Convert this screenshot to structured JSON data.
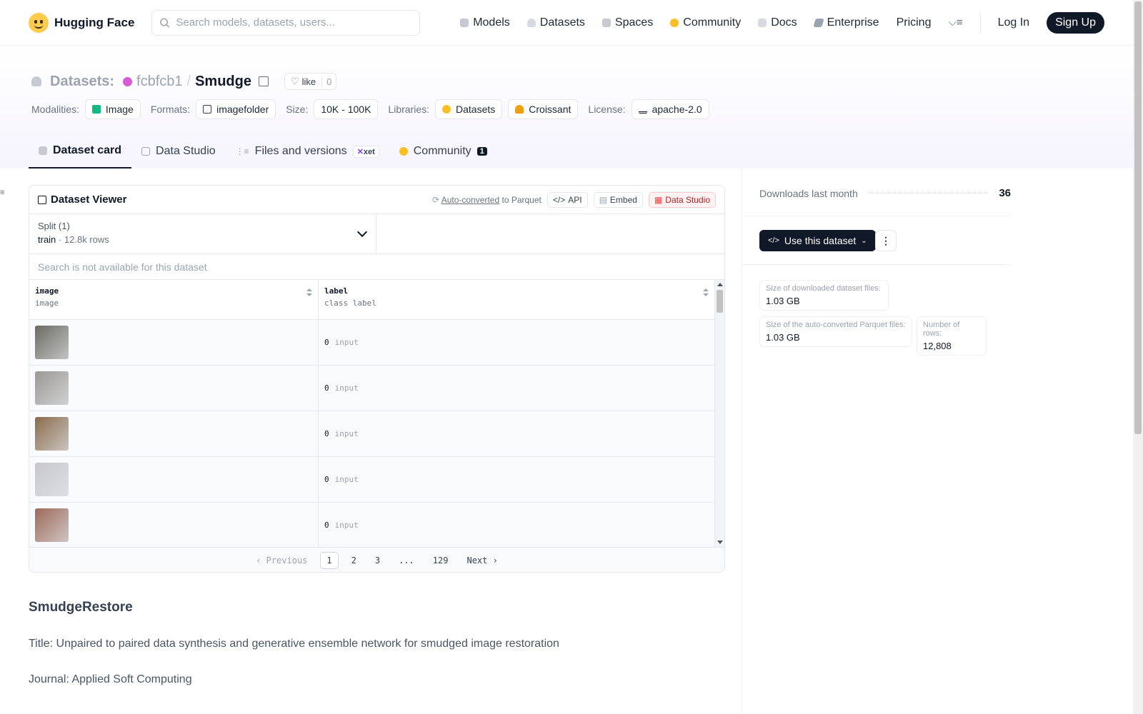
{
  "nav": {
    "brand": "Hugging Face",
    "search_placeholder": "Search models, datasets, users...",
    "links": [
      "Models",
      "Datasets",
      "Spaces",
      "Community",
      "Docs",
      "Enterprise",
      "Pricing"
    ],
    "login": "Log In",
    "signup": "Sign Up"
  },
  "header": {
    "section": "Datasets:",
    "owner": "fcbfcb1",
    "separator": "/",
    "name": "Smudge",
    "like_label": "like",
    "like_count": "0",
    "tags": {
      "modalities_label": "Modalities:",
      "modality": "Image",
      "formats_label": "Formats:",
      "format": "imagefolder",
      "size_label": "Size:",
      "size": "10K - 100K",
      "libraries_label": "Libraries:",
      "library1": "Datasets",
      "library2": "Croissant",
      "license_label": "License:",
      "license": "apache-2.0"
    }
  },
  "tabs": {
    "card": "Dataset card",
    "studio": "Data Studio",
    "files": "Files and versions",
    "xet": "xet",
    "community": "Community",
    "community_count": "1"
  },
  "viewer": {
    "title": "Dataset Viewer",
    "autoconv": "Auto-converted",
    "to_parquet": "to Parquet",
    "api": "API",
    "embed": "Embed",
    "studio": "Data Studio",
    "split_label": "Split (1)",
    "split_value": "train",
    "split_dot": "·",
    "split_rows": "12.8k rows",
    "search_note": "Search is not available for this dataset",
    "columns": [
      {
        "name": "image",
        "type": "image"
      },
      {
        "name": "label",
        "type": "class label"
      }
    ],
    "rows": [
      {
        "label_value": "0",
        "label_name": "input",
        "thumb_color": "#6b6a63"
      },
      {
        "label_value": "0",
        "label_name": "input",
        "thumb_color": "#9a9894"
      },
      {
        "label_value": "0",
        "label_name": "input",
        "thumb_color": "#8a6c4e"
      },
      {
        "label_value": "0",
        "label_name": "input",
        "thumb_color": "#c8c8cc"
      },
      {
        "label_value": "0",
        "label_name": "input",
        "thumb_color": "#9c6a5a"
      }
    ],
    "pager": {
      "previous": "Previous",
      "pages": [
        "1",
        "2",
        "3",
        "...",
        "129"
      ],
      "current": "1",
      "next": "Next"
    }
  },
  "card": {
    "heading": "SmudgeRestore",
    "title_line": "Title: Unpaired to paired data synthesis and generative ensemble network for smudged image restoration",
    "journal_line": "Journal: Applied Soft Computing"
  },
  "sidebar": {
    "downloads_label": "Downloads last month",
    "downloads_value": "36",
    "use_button": "Use this dataset",
    "stats": [
      {
        "label": "Size of downloaded dataset files:",
        "value": "1.03 GB"
      },
      {
        "label": "Size of the auto-converted Parquet files:",
        "value": "1.03 GB"
      },
      {
        "label": "Number of rows:",
        "value": "12,808"
      }
    ]
  },
  "colors": {
    "accent_dark": "#111827",
    "owner_dot": "#d65bd6",
    "studio_red": "#b91c1c"
  }
}
